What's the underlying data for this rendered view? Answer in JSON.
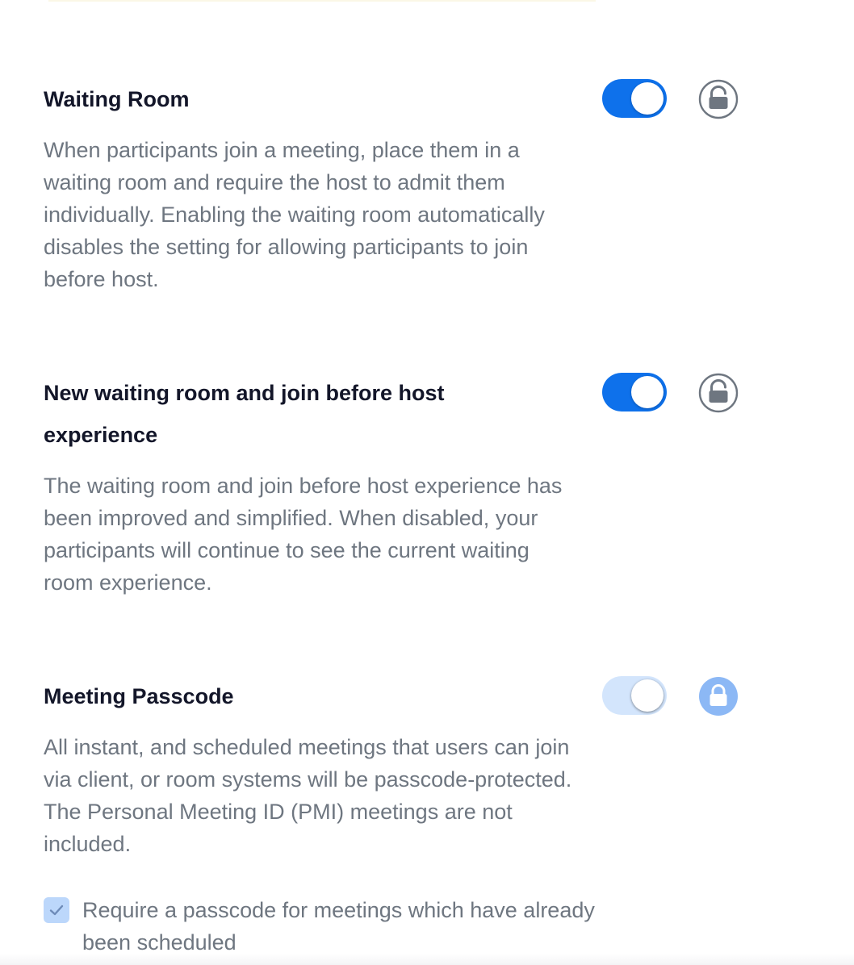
{
  "settings": [
    {
      "title": "Waiting Room",
      "description": "When participants join a meeting, place them in a waiting room and require the host to admit them individually. Enabling the waiting room automatically disables the setting for allowing participants to join before host.",
      "toggle_on": true,
      "toggle_enabled": true,
      "lock_icon": "lock-open-icon"
    },
    {
      "title": "New waiting room and join before host experience",
      "description": "The waiting room and join before host experience has been improved and simplified. When disabled, your participants will continue to see the current waiting room experience.",
      "toggle_on": true,
      "toggle_enabled": true,
      "lock_icon": "lock-open-icon"
    },
    {
      "title": "Meeting Passcode",
      "description": "All instant, and scheduled meetings that users can join via client, or room systems will be passcode-protected. The Personal Meeting ID (PMI) meetings are not included.",
      "toggle_on": true,
      "toggle_enabled": false,
      "lock_icon": "lock-closed-icon",
      "option": {
        "label": "Require a passcode for meetings which have already been scheduled",
        "checked": true
      }
    }
  ],
  "colors": {
    "accent": "#0e71eb",
    "accent_disabled": "#d3e5fc",
    "title": "#131629",
    "description": "#6e7680",
    "lock_open": "#6e7680",
    "lock_closed": "#8cb8f5"
  }
}
